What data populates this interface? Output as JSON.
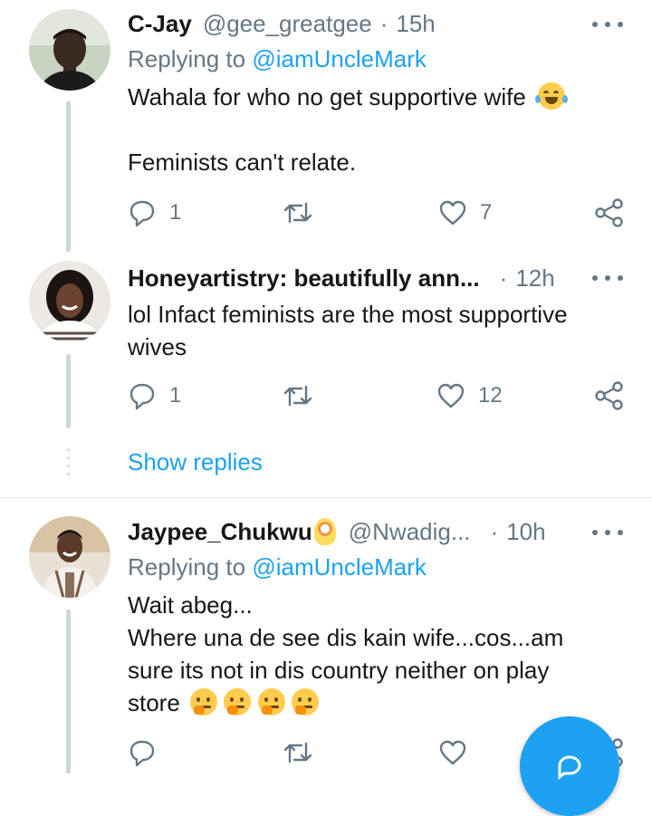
{
  "tweets": [
    {
      "name": "C-Jay",
      "handle": "@gee_greatgee",
      "separator": "·",
      "time": "15h",
      "replying_prefix": "Replying to",
      "replying_to": "@iamUncleMark",
      "text_line1": "Wahala for who no get supportive wife",
      "text_line2": "Feminists can't relate.",
      "emojis": [
        "face-with-tears-of-joy"
      ],
      "reply_count": "1",
      "retweet_count": "",
      "like_count": "7"
    },
    {
      "name": "Honeyartistry: beautifully ann...",
      "separator": "·",
      "time": "12h",
      "text_line1": "lol Infact feminists are the most supportive",
      "text_line2": "wives",
      "reply_count": "1",
      "retweet_count": "",
      "like_count": "12"
    },
    {
      "name": "Jaypee_Chukwu",
      "name_emoji": "ok-hand",
      "handle": "@Nwadig...",
      "separator": "·",
      "time": "10h",
      "replying_prefix": "Replying to",
      "replying_to": "@iamUncleMark",
      "text_line1": "Wait abeg...",
      "text_line2": "Where una de see dis kain wife...cos...am",
      "text_line3": "sure its not in dis country neither on play",
      "text_line4": "store",
      "emojis": [
        "thinking-face",
        "thinking-face",
        "thinking-face",
        "thinking-face"
      ],
      "reply_count": "",
      "retweet_count": "",
      "like_count": ""
    }
  ],
  "show_replies_label": "Show replies",
  "colors": {
    "accent": "#1da1f2",
    "secondary_text": "#657786",
    "thread_line": "#ccd6dd"
  },
  "icons": [
    "reply-icon",
    "retweet-icon",
    "like-icon",
    "share-icon",
    "more-icon",
    "compose-icon"
  ]
}
